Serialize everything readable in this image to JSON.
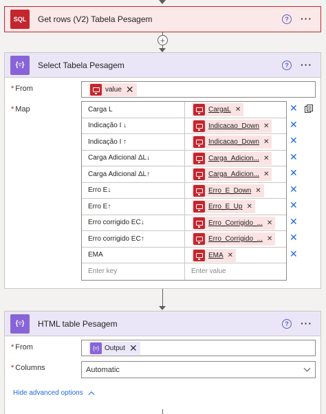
{
  "colors": {
    "sql_red": "#c4262e",
    "purple": "#8764d8",
    "link_blue": "#2266e3"
  },
  "get_rows": {
    "title": "Get rows (V2) Tabela Pesagem",
    "icon": "sql-icon",
    "icon_text": "SQL"
  },
  "select": {
    "title": "Select Tabela Pesagem",
    "icon": "data-operation-icon",
    "from_label": "From",
    "from_token": "value",
    "map_label": "Map",
    "rows": [
      {
        "key": "Carga L",
        "value": "CargaL"
      },
      {
        "key": "Indicação I ↓",
        "value": "Indicacao_Down"
      },
      {
        "key": "Indicação I ↑",
        "value": "Indicacao_Down"
      },
      {
        "key": "Carga Adicional ΔL↓",
        "value": "Carga_Adicion..."
      },
      {
        "key": "Carga Adicional  ΔL↑",
        "value": "Carga_Adicion..."
      },
      {
        "key": "Erro E↓",
        "value": "Erro_E_Down"
      },
      {
        "key": "Erro E↑",
        "value": "Erro_E_Up"
      },
      {
        "key": "Erro corrigido EC↓",
        "value": "Erro_Corrigido_..."
      },
      {
        "key": "Erro corrigido EC↑",
        "value": "Erro_Corrigido_..."
      },
      {
        "key": "EMA",
        "value": "EMA"
      }
    ],
    "enter_key": "Enter key",
    "enter_value": "Enter value"
  },
  "html_table": {
    "title": "HTML table Pesagem",
    "icon": "data-operation-icon",
    "from_label": "From",
    "from_token": "Output",
    "columns_label": "Columns",
    "columns_value": "Automatic",
    "hide_options": "Hide advanced options"
  },
  "help_glyph": "?",
  "more_glyph": "···"
}
